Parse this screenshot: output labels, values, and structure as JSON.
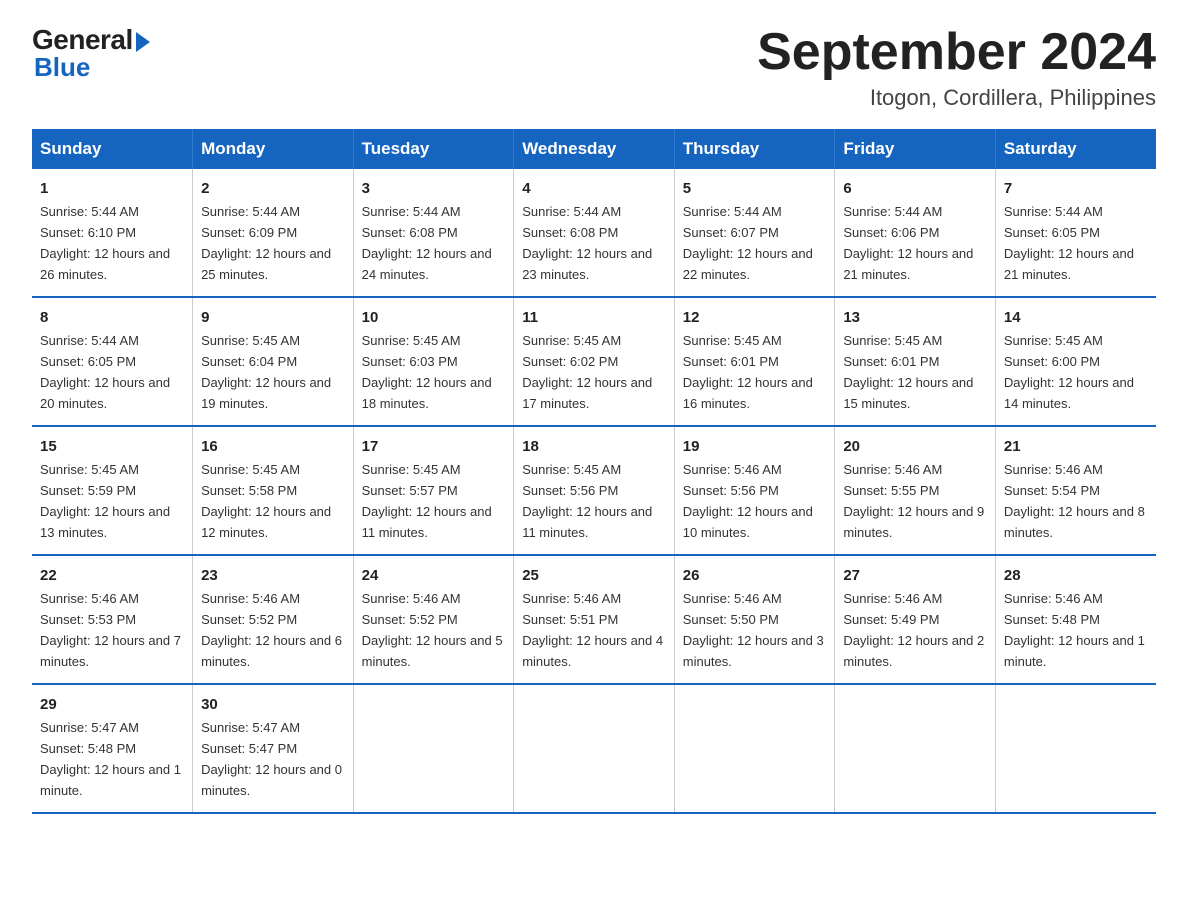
{
  "logo": {
    "general": "General",
    "blue": "Blue"
  },
  "header": {
    "title": "September 2024",
    "subtitle": "Itogon, Cordillera, Philippines"
  },
  "days_of_week": [
    "Sunday",
    "Monday",
    "Tuesday",
    "Wednesday",
    "Thursday",
    "Friday",
    "Saturday"
  ],
  "weeks": [
    [
      {
        "day": "1",
        "sunrise": "5:44 AM",
        "sunset": "6:10 PM",
        "daylight": "12 hours and 26 minutes"
      },
      {
        "day": "2",
        "sunrise": "5:44 AM",
        "sunset": "6:09 PM",
        "daylight": "12 hours and 25 minutes"
      },
      {
        "day": "3",
        "sunrise": "5:44 AM",
        "sunset": "6:08 PM",
        "daylight": "12 hours and 24 minutes"
      },
      {
        "day": "4",
        "sunrise": "5:44 AM",
        "sunset": "6:08 PM",
        "daylight": "12 hours and 23 minutes"
      },
      {
        "day": "5",
        "sunrise": "5:44 AM",
        "sunset": "6:07 PM",
        "daylight": "12 hours and 22 minutes"
      },
      {
        "day": "6",
        "sunrise": "5:44 AM",
        "sunset": "6:06 PM",
        "daylight": "12 hours and 21 minutes"
      },
      {
        "day": "7",
        "sunrise": "5:44 AM",
        "sunset": "6:05 PM",
        "daylight": "12 hours and 21 minutes"
      }
    ],
    [
      {
        "day": "8",
        "sunrise": "5:44 AM",
        "sunset": "6:05 PM",
        "daylight": "12 hours and 20 minutes"
      },
      {
        "day": "9",
        "sunrise": "5:45 AM",
        "sunset": "6:04 PM",
        "daylight": "12 hours and 19 minutes"
      },
      {
        "day": "10",
        "sunrise": "5:45 AM",
        "sunset": "6:03 PM",
        "daylight": "12 hours and 18 minutes"
      },
      {
        "day": "11",
        "sunrise": "5:45 AM",
        "sunset": "6:02 PM",
        "daylight": "12 hours and 17 minutes"
      },
      {
        "day": "12",
        "sunrise": "5:45 AM",
        "sunset": "6:01 PM",
        "daylight": "12 hours and 16 minutes"
      },
      {
        "day": "13",
        "sunrise": "5:45 AM",
        "sunset": "6:01 PM",
        "daylight": "12 hours and 15 minutes"
      },
      {
        "day": "14",
        "sunrise": "5:45 AM",
        "sunset": "6:00 PM",
        "daylight": "12 hours and 14 minutes"
      }
    ],
    [
      {
        "day": "15",
        "sunrise": "5:45 AM",
        "sunset": "5:59 PM",
        "daylight": "12 hours and 13 minutes"
      },
      {
        "day": "16",
        "sunrise": "5:45 AM",
        "sunset": "5:58 PM",
        "daylight": "12 hours and 12 minutes"
      },
      {
        "day": "17",
        "sunrise": "5:45 AM",
        "sunset": "5:57 PM",
        "daylight": "12 hours and 11 minutes"
      },
      {
        "day": "18",
        "sunrise": "5:45 AM",
        "sunset": "5:56 PM",
        "daylight": "12 hours and 11 minutes"
      },
      {
        "day": "19",
        "sunrise": "5:46 AM",
        "sunset": "5:56 PM",
        "daylight": "12 hours and 10 minutes"
      },
      {
        "day": "20",
        "sunrise": "5:46 AM",
        "sunset": "5:55 PM",
        "daylight": "12 hours and 9 minutes"
      },
      {
        "day": "21",
        "sunrise": "5:46 AM",
        "sunset": "5:54 PM",
        "daylight": "12 hours and 8 minutes"
      }
    ],
    [
      {
        "day": "22",
        "sunrise": "5:46 AM",
        "sunset": "5:53 PM",
        "daylight": "12 hours and 7 minutes"
      },
      {
        "day": "23",
        "sunrise": "5:46 AM",
        "sunset": "5:52 PM",
        "daylight": "12 hours and 6 minutes"
      },
      {
        "day": "24",
        "sunrise": "5:46 AM",
        "sunset": "5:52 PM",
        "daylight": "12 hours and 5 minutes"
      },
      {
        "day": "25",
        "sunrise": "5:46 AM",
        "sunset": "5:51 PM",
        "daylight": "12 hours and 4 minutes"
      },
      {
        "day": "26",
        "sunrise": "5:46 AM",
        "sunset": "5:50 PM",
        "daylight": "12 hours and 3 minutes"
      },
      {
        "day": "27",
        "sunrise": "5:46 AM",
        "sunset": "5:49 PM",
        "daylight": "12 hours and 2 minutes"
      },
      {
        "day": "28",
        "sunrise": "5:46 AM",
        "sunset": "5:48 PM",
        "daylight": "12 hours and 1 minute"
      }
    ],
    [
      {
        "day": "29",
        "sunrise": "5:47 AM",
        "sunset": "5:48 PM",
        "daylight": "12 hours and 1 minute"
      },
      {
        "day": "30",
        "sunrise": "5:47 AM",
        "sunset": "5:47 PM",
        "daylight": "12 hours and 0 minutes"
      },
      null,
      null,
      null,
      null,
      null
    ]
  ]
}
